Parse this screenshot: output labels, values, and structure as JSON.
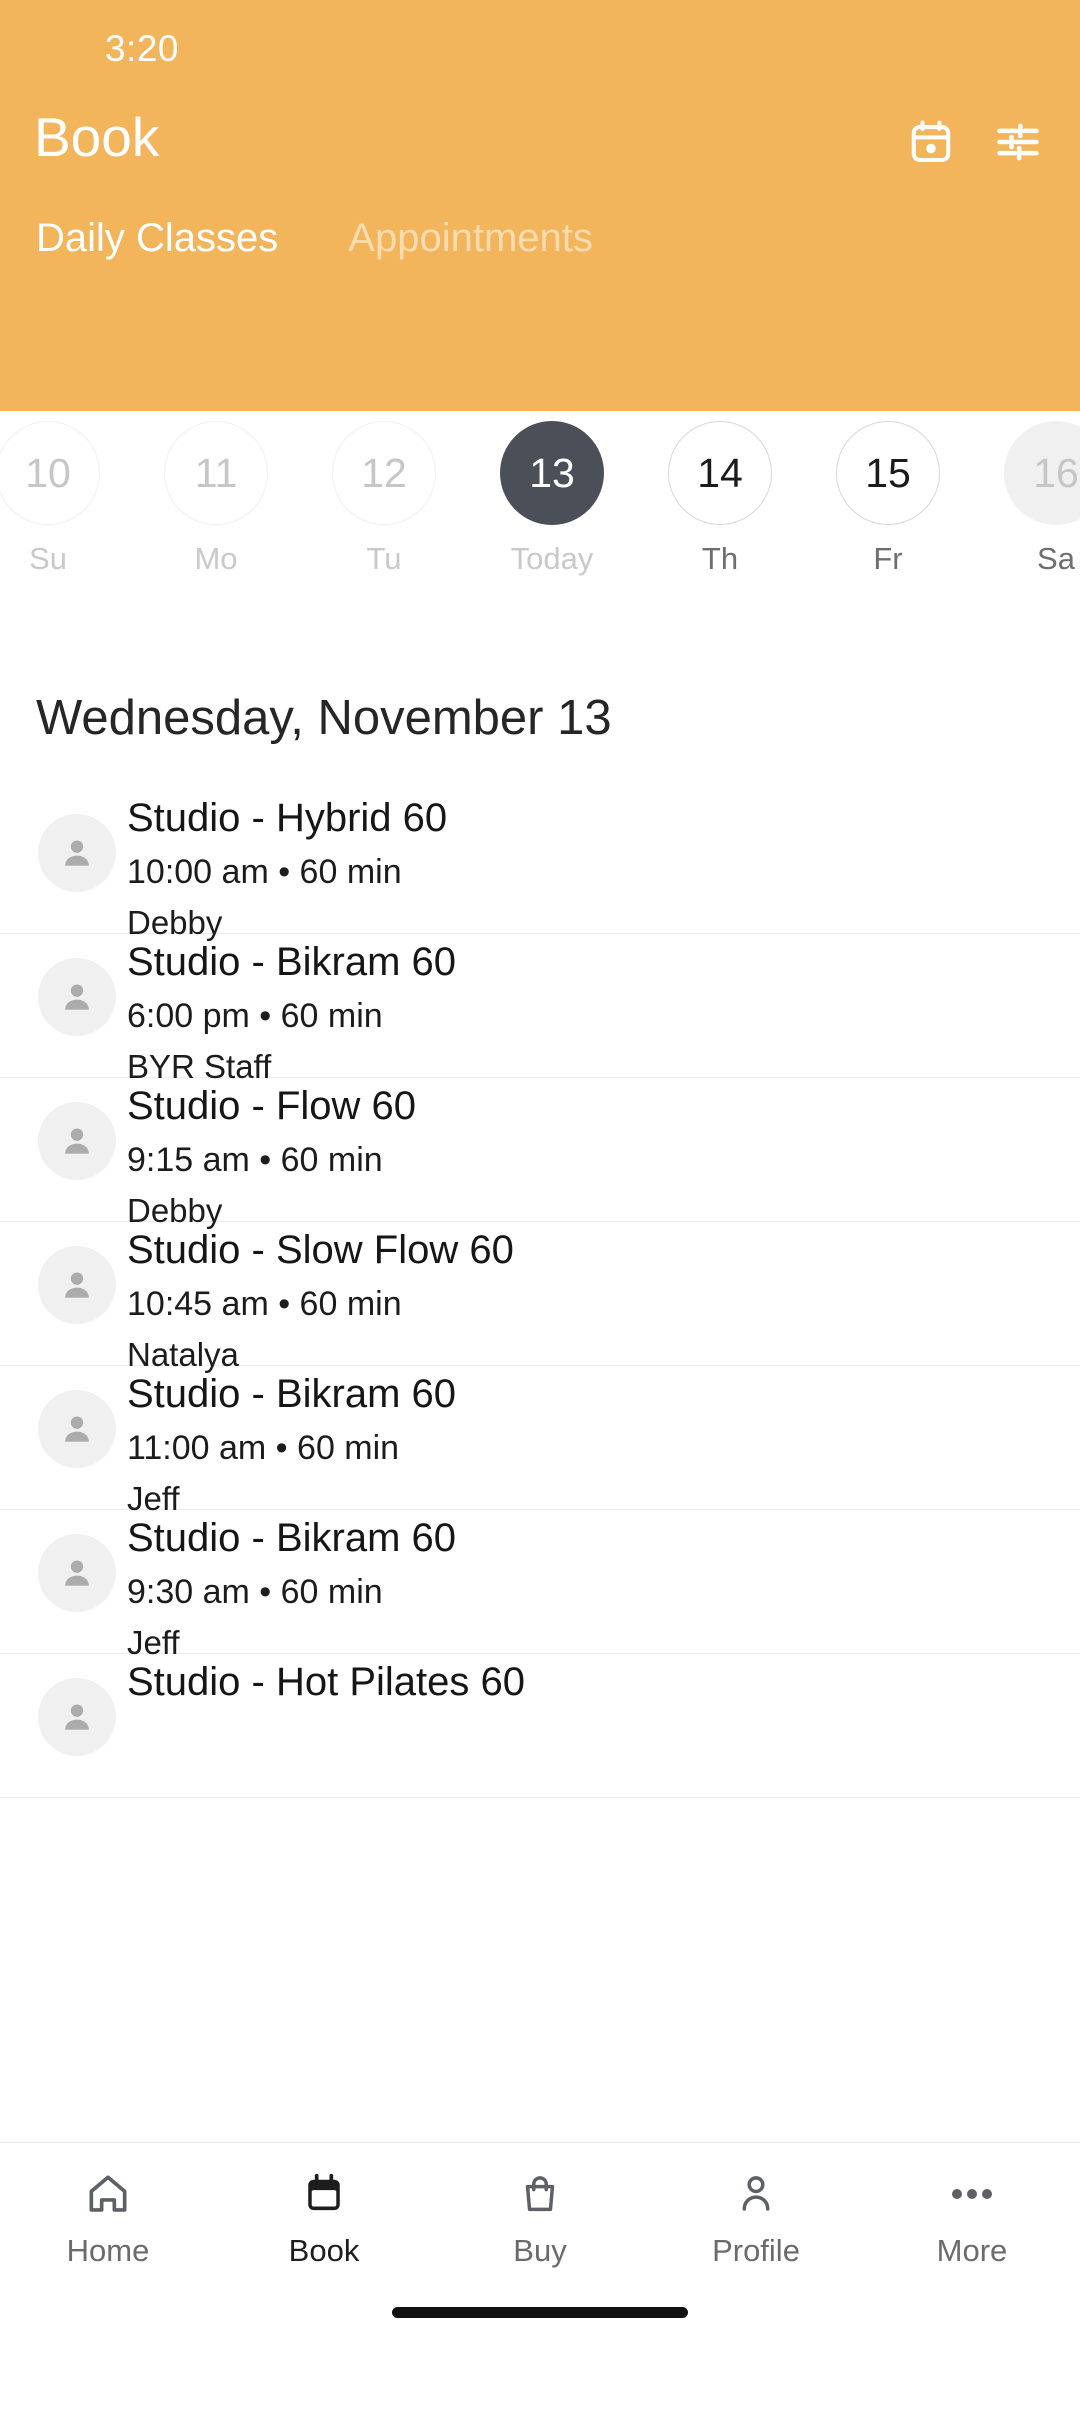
{
  "theme": {
    "header_bg": "#f2b55c",
    "header_text": "#ffffff",
    "header_text_inactive": "#fbdcb0",
    "today_pill_bg": "#4b4f58",
    "page_bg": "#ffffff",
    "divider": "#ececec"
  },
  "status_bar": {
    "time": "3:20"
  },
  "header": {
    "title": "Book",
    "actions": [
      {
        "name": "calendar-icon",
        "label": "calendar-icon"
      },
      {
        "name": "tune-icon",
        "label": "filter-icon"
      }
    ]
  },
  "tabs": [
    {
      "label": "Daily Classes",
      "active": true
    },
    {
      "label": "Appointments",
      "active": false
    }
  ],
  "date_strip": [
    {
      "day": "10",
      "weekday": "Su",
      "state": "past"
    },
    {
      "day": "11",
      "weekday": "Mo",
      "state": "past"
    },
    {
      "day": "12",
      "weekday": "Tu",
      "state": "past"
    },
    {
      "day": "13",
      "weekday": "Today",
      "state": "today"
    },
    {
      "day": "14",
      "weekday": "Th",
      "state": "future"
    },
    {
      "day": "15",
      "weekday": "Fr",
      "state": "future"
    },
    {
      "day": "16",
      "weekday": "Sa",
      "state": "shaded"
    }
  ],
  "day_heading": "Wednesday, November 13",
  "classes": [
    {
      "title": "Studio - Hybrid 60",
      "meta": "10:00 am • 60 min",
      "staff": "Debby"
    },
    {
      "title": "Studio - Bikram 60",
      "meta": "6:00 pm • 60 min",
      "staff": "BYR Staff"
    },
    {
      "title": "Studio - Flow 60",
      "meta": "9:15 am • 60 min",
      "staff": "Debby"
    },
    {
      "title": "Studio - Slow Flow 60",
      "meta": "10:45 am • 60 min",
      "staff": "Natalya"
    },
    {
      "title": "Studio - Bikram 60",
      "meta": "11:00 am • 60 min",
      "staff": "Jeff"
    },
    {
      "title": "Studio - Bikram 60",
      "meta": "9:30 am • 60 min",
      "staff": "Jeff"
    },
    {
      "title": "Studio - Hot Pilates 60",
      "meta": "",
      "staff": ""
    }
  ],
  "bottom_nav": [
    {
      "label": "Home",
      "icon": "home-icon",
      "active": false
    },
    {
      "label": "Book",
      "icon": "calendar-icon",
      "active": true
    },
    {
      "label": "Buy",
      "icon": "bag-icon",
      "active": false
    },
    {
      "label": "Profile",
      "icon": "person-icon",
      "active": false
    },
    {
      "label": "More",
      "icon": "more-icon",
      "active": false
    }
  ]
}
